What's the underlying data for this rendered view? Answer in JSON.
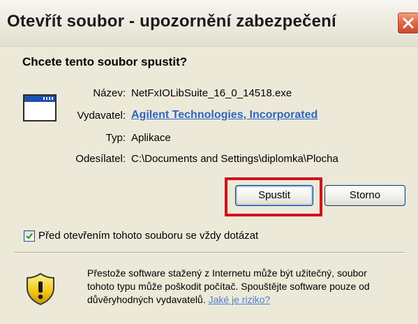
{
  "window": {
    "title": "Otevřít soubor - upozornění zabezpečení"
  },
  "dialog": {
    "question": "Chcete tento soubor spustit?",
    "fields": {
      "name_label": "Název:",
      "name_value": "NetFxIOLibSuite_16_0_14518.exe",
      "publisher_label": "Vydavatel:",
      "publisher_value": "Agilent Technologies, Incorporated",
      "type_label": "Typ:",
      "type_value": "Aplikace",
      "from_label": "Odesílatel:",
      "from_value": "C:\\Documents and Settings\\diplomka\\Plocha"
    },
    "buttons": {
      "run": "Spustit",
      "cancel": "Storno"
    },
    "checkbox": {
      "label": "Před otevřením tohoto souboru se vždy dotázat",
      "checked": true
    },
    "warning": {
      "line1": "Přestože software stažený z Internetu může být užitečný, soubor",
      "line2": "tohoto typu může poškodit počítač. Spouštějte software pouze od",
      "line3": "důvěryhodných vydavatelů.",
      "link": "Jaké je riziko?"
    }
  },
  "colors": {
    "dialog_bg": "#ece9d8",
    "link": "#2c65c9",
    "highlight": "#d1121b",
    "close_button": "#e06d49"
  },
  "icons": {
    "close": "close-icon",
    "application": "application-window-icon",
    "checkmark": "checkmark-icon",
    "shield": "security-shield-warning-icon"
  }
}
